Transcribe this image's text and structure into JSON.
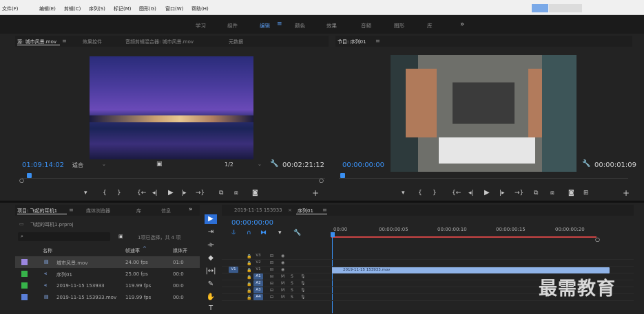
{
  "menubar": {
    "items": [
      "文件(F)",
      "编辑(E)",
      "剪辑(C)",
      "序列(S)",
      "标记(M)",
      "图形(G)",
      "窗口(W)",
      "帮助(H)"
    ]
  },
  "workspaces": {
    "items": [
      "学习",
      "组件",
      "编辑",
      "颜色",
      "效果",
      "音频",
      "图形",
      "库"
    ],
    "active": "编辑",
    "more": "»"
  },
  "source": {
    "tabs": [
      "源: 城市风景.mov",
      "效果控件",
      "音频剪辑混合器: 城市风景.mov",
      "元数据"
    ],
    "timecode": "01:09:14:02",
    "fit": "适合",
    "res": "1/2",
    "duration": "00:02:21:12",
    "fx_icon": "wrench-icon"
  },
  "program": {
    "tab": "节目: 序列01",
    "timecode": "00:00:00:00",
    "duration": "00:00:01:09"
  },
  "project": {
    "tabs": [
      "项目: 飞起的耳机1",
      "媒体浏览器",
      "库",
      "信息"
    ],
    "more": "»",
    "file": "飞起的耳机1.prproj",
    "selection": "1项已选择，共 4 项",
    "columns": {
      "name": "名称",
      "rate": "帧速率",
      "start": "媒体开"
    },
    "rows": [
      {
        "name": "城市风景.mov",
        "rate": "24.00 fps",
        "start": "01:0",
        "color": "#9b86e0",
        "icon": "film-icon",
        "selected": true
      },
      {
        "name": "序列01",
        "rate": "25.00 fps",
        "start": "00:0",
        "color": "#37b34a",
        "icon": "sequence-icon",
        "selected": false
      },
      {
        "name": "2019-11-15 153933",
        "rate": "119.99 fps",
        "start": "00:0",
        "color": "#37b34a",
        "icon": "sequence-icon",
        "selected": false
      },
      {
        "name": "2019-11-15 153933.mov",
        "rate": "119.99 fps",
        "start": "00:0",
        "color": "#5a7fd8",
        "icon": "film-icon",
        "selected": false
      }
    ]
  },
  "timeline": {
    "tabs": [
      "2019-11-15 153933",
      "序列01"
    ],
    "timecode": "00:00:00:00",
    "ruler": [
      "00:00",
      "00:00:00:05",
      "00:00:00:10",
      "00:00:00:15",
      "00:00:00:20"
    ],
    "video_tracks": [
      "V3",
      "V2",
      "V1"
    ],
    "audio_tracks": [
      "A1",
      "A2",
      "A3",
      "A4"
    ],
    "clip": "2019-11-15 153933.mov",
    "source_patch": "V1",
    "mute": "M",
    "solo": "S"
  },
  "watermark": "最需教育"
}
